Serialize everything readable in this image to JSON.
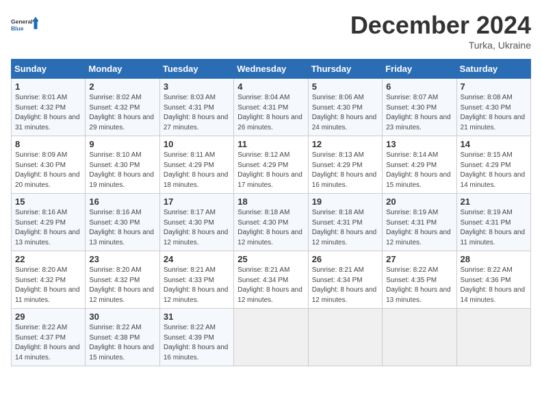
{
  "logo": {
    "general": "General",
    "blue": "Blue"
  },
  "title": "December 2024",
  "location": "Turka, Ukraine",
  "days_header": [
    "Sunday",
    "Monday",
    "Tuesday",
    "Wednesday",
    "Thursday",
    "Friday",
    "Saturday"
  ],
  "weeks": [
    [
      {
        "day": "1",
        "sunrise": "8:01 AM",
        "sunset": "4:32 PM",
        "daylight": "8 hours and 31 minutes."
      },
      {
        "day": "2",
        "sunrise": "8:02 AM",
        "sunset": "4:32 PM",
        "daylight": "8 hours and 29 minutes."
      },
      {
        "day": "3",
        "sunrise": "8:03 AM",
        "sunset": "4:31 PM",
        "daylight": "8 hours and 27 minutes."
      },
      {
        "day": "4",
        "sunrise": "8:04 AM",
        "sunset": "4:31 PM",
        "daylight": "8 hours and 26 minutes."
      },
      {
        "day": "5",
        "sunrise": "8:06 AM",
        "sunset": "4:30 PM",
        "daylight": "8 hours and 24 minutes."
      },
      {
        "day": "6",
        "sunrise": "8:07 AM",
        "sunset": "4:30 PM",
        "daylight": "8 hours and 23 minutes."
      },
      {
        "day": "7",
        "sunrise": "8:08 AM",
        "sunset": "4:30 PM",
        "daylight": "8 hours and 21 minutes."
      }
    ],
    [
      {
        "day": "8",
        "sunrise": "8:09 AM",
        "sunset": "4:30 PM",
        "daylight": "8 hours and 20 minutes."
      },
      {
        "day": "9",
        "sunrise": "8:10 AM",
        "sunset": "4:30 PM",
        "daylight": "8 hours and 19 minutes."
      },
      {
        "day": "10",
        "sunrise": "8:11 AM",
        "sunset": "4:29 PM",
        "daylight": "8 hours and 18 minutes."
      },
      {
        "day": "11",
        "sunrise": "8:12 AM",
        "sunset": "4:29 PM",
        "daylight": "8 hours and 17 minutes."
      },
      {
        "day": "12",
        "sunrise": "8:13 AM",
        "sunset": "4:29 PM",
        "daylight": "8 hours and 16 minutes."
      },
      {
        "day": "13",
        "sunrise": "8:14 AM",
        "sunset": "4:29 PM",
        "daylight": "8 hours and 15 minutes."
      },
      {
        "day": "14",
        "sunrise": "8:15 AM",
        "sunset": "4:29 PM",
        "daylight": "8 hours and 14 minutes."
      }
    ],
    [
      {
        "day": "15",
        "sunrise": "8:16 AM",
        "sunset": "4:29 PM",
        "daylight": "8 hours and 13 minutes."
      },
      {
        "day": "16",
        "sunrise": "8:16 AM",
        "sunset": "4:30 PM",
        "daylight": "8 hours and 13 minutes."
      },
      {
        "day": "17",
        "sunrise": "8:17 AM",
        "sunset": "4:30 PM",
        "daylight": "8 hours and 12 minutes."
      },
      {
        "day": "18",
        "sunrise": "8:18 AM",
        "sunset": "4:30 PM",
        "daylight": "8 hours and 12 minutes."
      },
      {
        "day": "19",
        "sunrise": "8:18 AM",
        "sunset": "4:31 PM",
        "daylight": "8 hours and 12 minutes."
      },
      {
        "day": "20",
        "sunrise": "8:19 AM",
        "sunset": "4:31 PM",
        "daylight": "8 hours and 12 minutes."
      },
      {
        "day": "21",
        "sunrise": "8:19 AM",
        "sunset": "4:31 PM",
        "daylight": "8 hours and 11 minutes."
      }
    ],
    [
      {
        "day": "22",
        "sunrise": "8:20 AM",
        "sunset": "4:32 PM",
        "daylight": "8 hours and 11 minutes."
      },
      {
        "day": "23",
        "sunrise": "8:20 AM",
        "sunset": "4:32 PM",
        "daylight": "8 hours and 12 minutes."
      },
      {
        "day": "24",
        "sunrise": "8:21 AM",
        "sunset": "4:33 PM",
        "daylight": "8 hours and 12 minutes."
      },
      {
        "day": "25",
        "sunrise": "8:21 AM",
        "sunset": "4:34 PM",
        "daylight": "8 hours and 12 minutes."
      },
      {
        "day": "26",
        "sunrise": "8:21 AM",
        "sunset": "4:34 PM",
        "daylight": "8 hours and 12 minutes."
      },
      {
        "day": "27",
        "sunrise": "8:22 AM",
        "sunset": "4:35 PM",
        "daylight": "8 hours and 13 minutes."
      },
      {
        "day": "28",
        "sunrise": "8:22 AM",
        "sunset": "4:36 PM",
        "daylight": "8 hours and 14 minutes."
      }
    ],
    [
      {
        "day": "29",
        "sunrise": "8:22 AM",
        "sunset": "4:37 PM",
        "daylight": "8 hours and 14 minutes."
      },
      {
        "day": "30",
        "sunrise": "8:22 AM",
        "sunset": "4:38 PM",
        "daylight": "8 hours and 15 minutes."
      },
      {
        "day": "31",
        "sunrise": "8:22 AM",
        "sunset": "4:39 PM",
        "daylight": "8 hours and 16 minutes."
      },
      null,
      null,
      null,
      null
    ]
  ]
}
